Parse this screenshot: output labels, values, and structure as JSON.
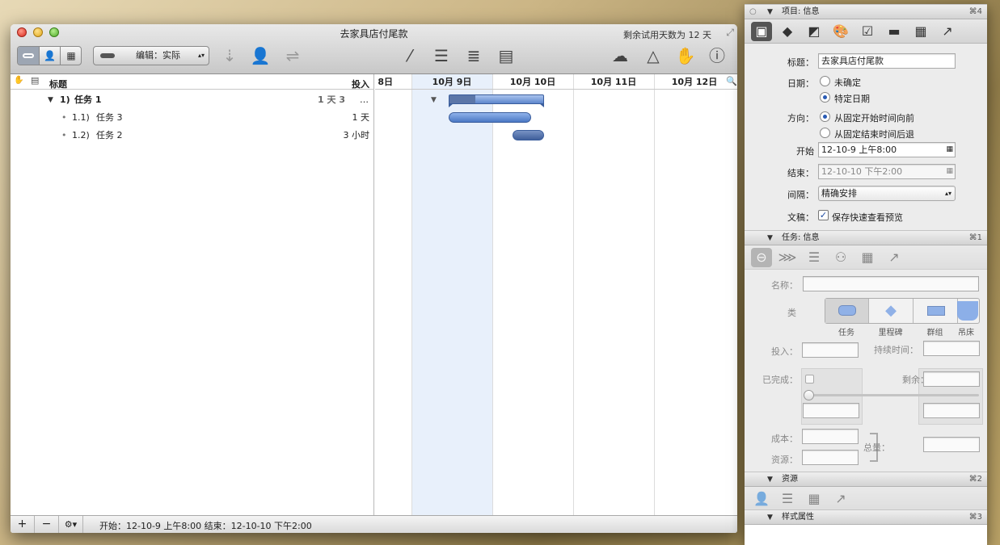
{
  "window": {
    "title": "去家具店付尾款",
    "trial": "剩余试用天数为 12 天"
  },
  "toolbar": {
    "edit_mode": "编辑：实际"
  },
  "outline": {
    "col_title": "标题",
    "col_effort": "投入",
    "rows": [
      {
        "num": "1)",
        "name": "任务 1",
        "effort": "1 天 3",
        "more": "…"
      },
      {
        "num": "1.1)",
        "name": "任务 3",
        "effort": "1 天"
      },
      {
        "num": "1.2)",
        "name": "任务 2",
        "effort": "3 小时"
      }
    ]
  },
  "gantt": {
    "dates": [
      "8日",
      "10月 9日",
      "10月 10日",
      "10月 11日",
      "10月 12日"
    ]
  },
  "statusbar": {
    "text": "开始：12-10-9 上午8:00 结束：12-10-10 下午2:00"
  },
  "inspector": {
    "project_section": {
      "title": "项目: 信息",
      "shortcut": "⌘4"
    },
    "title_label": "标题：",
    "title_value": "去家具店付尾款",
    "date_label": "日期：",
    "date_opt1": "未确定",
    "date_opt2": "特定日期",
    "dir_label": "方向：",
    "dir_opt1": "从固定开始时间向前",
    "dir_opt2": "从固定结束时间后退",
    "start_label": "开始",
    "start_value": "12-10-9 上午8:00",
    "end_label": "结束：",
    "end_value": "12-10-10 下午2:00",
    "gran_label": "间隔：",
    "gran_value": "精确安排",
    "doc_label": "文稿：",
    "doc_check": "保存快速查看预览",
    "task_section": {
      "title": "任务: 信息",
      "shortcut": "⌘1"
    },
    "name_label": "名称：",
    "type_label": "类",
    "types": [
      "任务",
      "里程碑",
      "群组",
      "吊床"
    ],
    "effort_label": "投入：",
    "duration_label": "持续时间：",
    "completed_label": "已完成：",
    "remaining_label": "剩余：",
    "cost_label": "成本：",
    "resource_label": "资源：",
    "total_label": "总量：",
    "resources_section": {
      "title": "资源",
      "shortcut": "⌘2"
    },
    "style_section": {
      "title": "样式属性",
      "shortcut": "⌘3"
    }
  }
}
